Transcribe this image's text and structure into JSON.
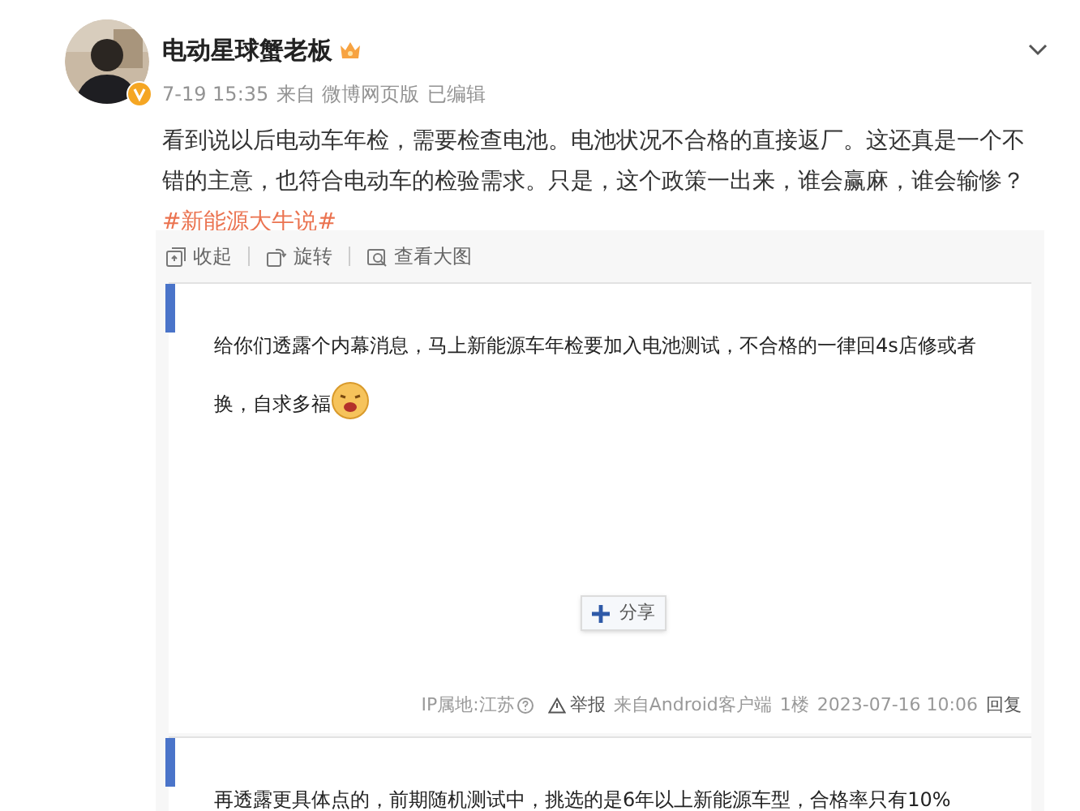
{
  "author": {
    "name": "电动星球蟹老板",
    "time": "7-19 15:35",
    "source": "来自 微博网页版",
    "edited": "已编辑"
  },
  "post": {
    "text": "看到说以后电动车年检，需要检查电池。电池状况不合格的直接返厂。这还真是一个不错的主意，也符合电动车的检验需求。只是，这个政策一出来，谁会赢麻，谁会输惨？",
    "hashtag": "#新能源大牛说#"
  },
  "image_toolbar": [
    {
      "kind": "collapse",
      "label": "收起"
    },
    {
      "kind": "rotate",
      "label": "旋转"
    },
    {
      "kind": "zoom",
      "label": "查看大图"
    }
  ],
  "embedded_replies": [
    {
      "text": "给你们透露个内幕消息，马上新能源车年检要加入电池测试，不合格的一律回4s店修或者换，自求多福",
      "emoji": true,
      "share_label": "分享",
      "footer": {
        "ip": "IP属地:江苏",
        "report": "举报",
        "source": "来自Android客户端",
        "floor": "1楼",
        "date": "2023-07-16 10:06",
        "reply": "回复"
      }
    },
    {
      "text": "再透露更具体点的，前期随机测试中，挑选的是6年以上新能源车型，合格率只有10%",
      "emoji": false
    }
  ]
}
